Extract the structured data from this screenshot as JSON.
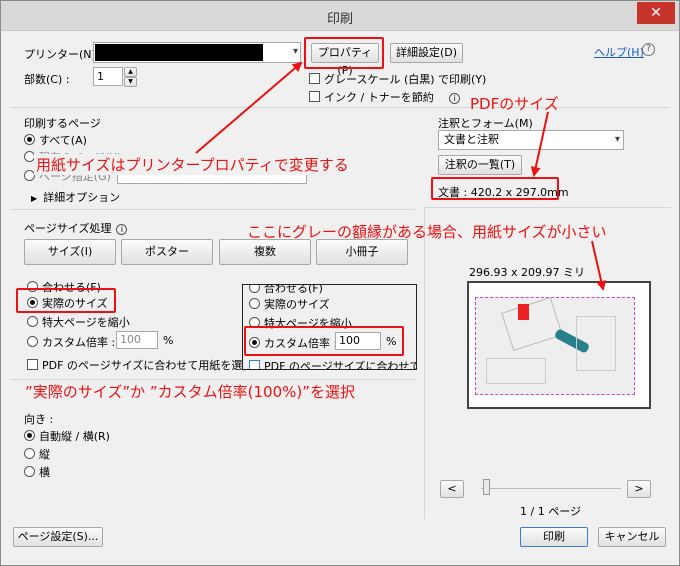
{
  "window": {
    "title": "印刷",
    "close_label": "✕"
  },
  "printer": {
    "label": "プリンター(N) :",
    "name": "",
    "properties_label": "プロパティ(P)",
    "advanced_label": "詳細設定(D)"
  },
  "help": {
    "label": "ヘルプ(H)",
    "icon": "?"
  },
  "copies": {
    "label": "部数(C) :",
    "value": "1"
  },
  "options": {
    "grayscale": "グレースケール (白黒) で印刷(Y)",
    "ink_save": "インク / トナーを節約",
    "info_icon": "i"
  },
  "pages": {
    "title": "印刷するページ",
    "all": "すべて(A)",
    "current": "現在のページ(U)",
    "range": "ページ指定(G)",
    "more": "詳細オプション",
    "expand_icon": "▶"
  },
  "page_size": {
    "title": "ページサイズ処理",
    "tabs": [
      "サイズ(I)",
      "ポスター",
      "複数",
      "小冊子"
    ],
    "fit": "合わせる(F)",
    "actual": "実際のサイズ",
    "shrink": "特大ページを縮小",
    "custom_label": "カスタム倍率 :",
    "custom_value": "100",
    "percent": "%",
    "pdf_paper": "PDF のページサイズに合わせて用紙を選択"
  },
  "zoom": {
    "fit": "合わせる(F)",
    "actual": "実際のサイズ",
    "shrink": "特大ページを縮小",
    "custom_label": "カスタム倍率 :",
    "custom_value": "100",
    "percent": "%",
    "pdf_paper": "PDF のページサイズに合わせて用"
  },
  "orientation": {
    "title": "向き :",
    "auto": "自動縦 / 横(R)",
    "portrait": "縦",
    "landscape": "横"
  },
  "comments": {
    "title": "注釈とフォーム(M)",
    "selected": "文書と注釈",
    "summary_label": "注釈の一覧(T)"
  },
  "doc_size": {
    "text": "文書 : 420.2 x 297.0mm"
  },
  "preview": {
    "size": "296.93 x 209.97 ミリ",
    "page_info": "1 / 1 ページ",
    "prev": "<",
    "next": ">"
  },
  "footer": {
    "page_setup": "ページ設定(S)...",
    "print": "印刷",
    "cancel": "キャンセル"
  },
  "annotations": {
    "pdf_size": "PDFのサイズ",
    "paper_size_note": "用紙サイズはプリンタープロパティで変更する",
    "gray_border_note": "ここにグレーの額縁がある場合、用紙サイズが小さい",
    "select_note": "”実際のサイズ”か ”カスタム倍率(100%)”を選択"
  },
  "colors": {
    "annotation_red": "#ee1111",
    "link_blue": "#1a5cc8",
    "close_red": "#c7342b"
  }
}
